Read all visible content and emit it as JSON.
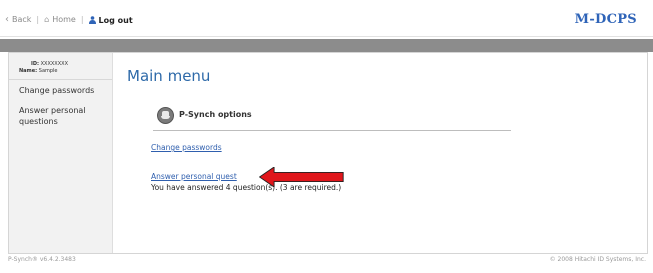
{
  "nav": {
    "back_label": "Back",
    "home_label": "Home",
    "logout_label": "Log out",
    "brand": "M-DCPS"
  },
  "sidebar": {
    "id_label": "ID:",
    "id_value": "XXXXXXXX",
    "name_label": "Name:",
    "name_value": "Sample",
    "items": [
      {
        "label": "Change passwords"
      },
      {
        "label": "Answer personal questions"
      }
    ]
  },
  "main": {
    "title": "Main menu",
    "section_title": "P-Synch options",
    "links": [
      {
        "label": "Change passwords"
      },
      {
        "label": "Answer personal quest"
      }
    ],
    "note": "You have answered 4 question(s). (3 are required.)"
  },
  "footer": {
    "left": "P-Synch® v6.4.2.3483",
    "right": "© 2008 Hitachi ID Systems, Inc."
  },
  "colors": {
    "accent": "#2f64b8",
    "arrow": "#e0161b",
    "band": "#8c8c8c"
  }
}
